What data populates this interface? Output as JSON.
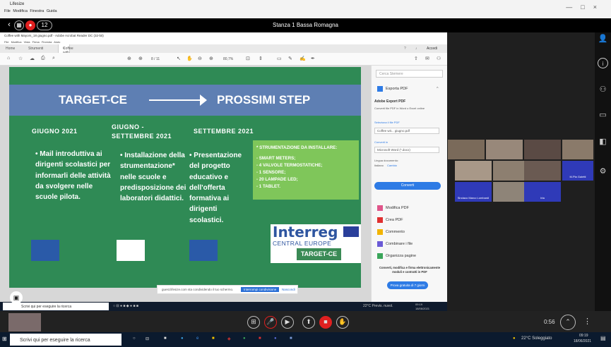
{
  "lifesize": {
    "app_name": "Lifesize",
    "menu": [
      "File",
      "Modifica",
      "Finestra",
      "Guida"
    ],
    "room_name": "Stanza 1 Bassa Romagna",
    "participant_count": "12",
    "call_timer": "0:56",
    "window_controls": [
      "—",
      "□",
      "×"
    ]
  },
  "acrobat": {
    "window_title": "Coffee with Mayors_18 giugno.pdf - Adobe Acrobat Reader DC (32-bit)",
    "menu": [
      "File",
      "Modifica",
      "Vista",
      "Firma",
      "Finestra",
      "Aiuto"
    ],
    "tabs": [
      "Home",
      "Strumenti",
      "Coffee with Mayors..."
    ],
    "access_label": "Accedi",
    "page_indicator": "8 / 11",
    "zoom": "80,7%",
    "pane": {
      "search_placeholder": "Cerca Stemere",
      "export_pdf": "Esporta PDF",
      "adobe_export_title": "Adobe Export PDF",
      "adobe_export_desc": "Converti file PDF in Word o Excel online",
      "select_file_label": "Seleziona il file PDF",
      "selected_file": "Coffee wit... giugno.pdf",
      "convert_to_label": "Converti in",
      "convert_to_value": "Microsoft Word (*.docx)",
      "doc_lang_label": "Lingua documento:",
      "doc_lang_value": "Italiano",
      "doc_lang_change": "Cambia",
      "convert_button": "Converti",
      "tools": [
        "Modifica PDF",
        "Crea PDF",
        "Commento",
        "Combinare i file",
        "Organizza pagine"
      ],
      "promo": "Converti, modifica e firma elettronicamente moduli e contratti in PDF",
      "try_button": "Prova gratuita di 7 giorni"
    }
  },
  "slide": {
    "title_left": "TARGET-CE",
    "title_right": "PROSSIMI STEP",
    "columns": [
      {
        "heading": "GIUGNO 2021",
        "body": "• Mail introduttiva ai dirigenti scolastici per informarli delle attività da svolgere nelle scuole pilota."
      },
      {
        "heading": "GIUGNO - SETTEMBRE 2021",
        "body": "• Installazione della strumentazione* nelle scuole e predisposizione dei laboratori didattici."
      },
      {
        "heading": "SETTEMBRE 2021",
        "body": "• Presentazione del progetto educativo e dell'offerta formativa ai dirigenti scolastici."
      }
    ],
    "equipment_title": "* STRUMENTAZIONE DA INSTALLARE:",
    "equipment_items": [
      "- SMART METERS;",
      "- 4 VALVOLE TERMOSTATICHE;",
      "- 1 SENSORE;",
      "- 20 LAMPADE LED;",
      "- 1 TABLET."
    ],
    "logo_word": "Interreg",
    "logo_sub": "CENTRAL EUROPE",
    "logo_badge": "TARGET-CE"
  },
  "share_notice": {
    "text": "guest.lifesize.com sta condividendo il tuo schermo.",
    "stop_button": "Interrompi condivisione",
    "hide_link": "Nascondi"
  },
  "inner_taskbar": {
    "search": "Scrivi qui per eseguire la ricerca",
    "weather": "22°C Previs. nuvol.",
    "time": "09:19",
    "date": "18/06/2021"
  },
  "participants": [
    {
      "label": ""
    },
    {
      "label": ""
    },
    {
      "label": ""
    },
    {
      "label": ""
    },
    {
      "label": ""
    },
    {
      "label": ""
    },
    {
      "label": ""
    },
    {
      "label": "M.Pia Galetti"
    },
    {
      "label": "Sindaco Marco Lombardi"
    },
    {
      "label": ""
    },
    {
      "label": "Irta"
    }
  ],
  "win_taskbar": {
    "search": "Scrivi qui per eseguire la ricerca",
    "weather": "22°C Soleggiato",
    "time": "09:19",
    "date": "18/06/2021"
  },
  "colors": {
    "slide_green": "#2f8a55",
    "header_blue": "#5e7fb3",
    "callout_green": "#7fc65a",
    "end_call_red": "#e02020"
  }
}
